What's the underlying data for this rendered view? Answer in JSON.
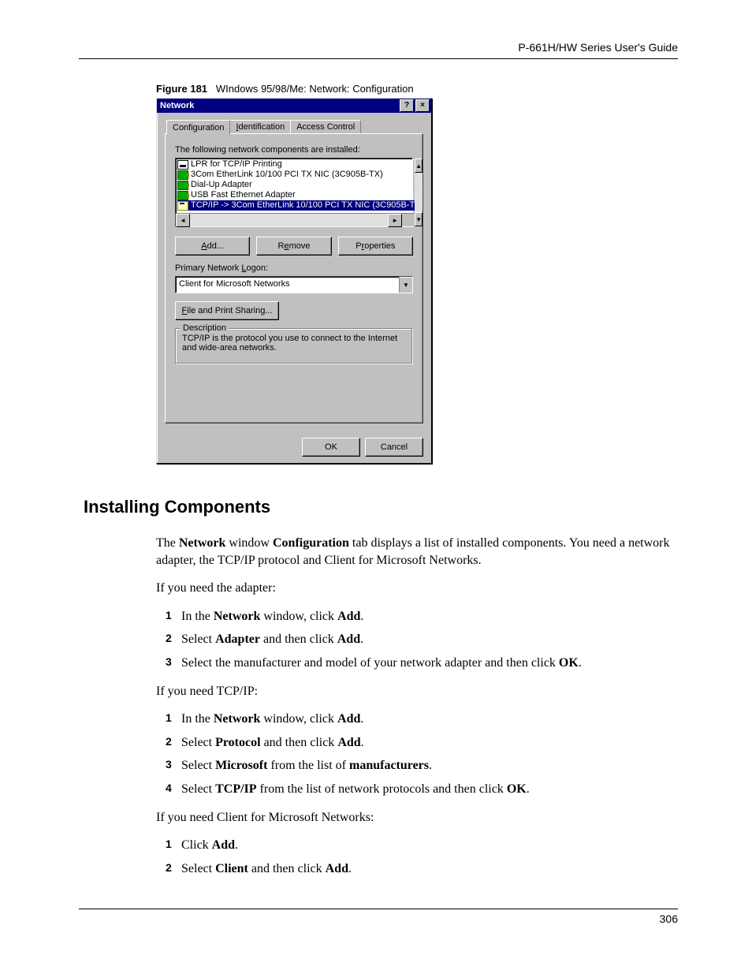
{
  "header": {
    "guide_title": "P-661H/HW Series User's Guide"
  },
  "figure": {
    "label": "Figure 181",
    "caption": "WIndows 95/98/Me: Network: Configuration"
  },
  "dialog": {
    "title": "Network",
    "title_help": "?",
    "title_close": "×",
    "tabs": {
      "configuration": "Configuration",
      "identification": "Identification",
      "access_control": "Access Control"
    },
    "list_label": "The following network components are installed:",
    "items": [
      "LPR for TCP/IP Printing",
      "3Com EtherLink 10/100 PCI TX NIC (3C905B-TX)",
      "Dial-Up Adapter",
      "USB Fast Ethernet Adapter",
      "TCP/IP -> 3Com EtherLink 10/100 PCI TX NIC (3C905B-T"
    ],
    "buttons": {
      "add": "Add...",
      "remove": "Remove",
      "properties": "Properties"
    },
    "primary_logon_label": "Primary Network Logon:",
    "primary_logon_value": "Client for Microsoft Networks",
    "file_print": "File and Print Sharing...",
    "desc_label": "Description",
    "desc_text": "TCP/IP is the protocol you use to connect to the Internet and wide-area networks.",
    "ok": "OK",
    "cancel": "Cancel"
  },
  "section_heading": "Installing Components",
  "intro": {
    "p1a": "The ",
    "p1b": "Network",
    "p1c": " window ",
    "p1d": "Configuration",
    "p1e": " tab displays a list of installed components. You need a network adapter, the TCP/IP protocol and Client for Microsoft Networks.",
    "p2": "If you need the adapter:"
  },
  "adapter_steps": {
    "s1a": "In the ",
    "s1b": "Network",
    "s1c": " window, click ",
    "s1d": "Add",
    "s1e": ".",
    "s2a": "Select ",
    "s2b": "Adapter",
    "s2c": " and then click ",
    "s2d": "Add",
    "s2e": ".",
    "s3a": "Select the manufacturer and model of your network adapter and then click ",
    "s3b": "OK",
    "s3c": "."
  },
  "tcpip_label": "If you need TCP/IP:",
  "tcpip_steps": {
    "s1a": "In the ",
    "s1b": "Network",
    "s1c": " window, click ",
    "s1d": "Add",
    "s1e": ".",
    "s2a": "Select ",
    "s2b": "Protocol",
    "s2c": " and then click ",
    "s2d": "Add",
    "s2e": ".",
    "s3a": "Select ",
    "s3b": "Microsoft",
    "s3c": " from the list of ",
    "s3d": "manufacturers",
    "s3e": ".",
    "s4a": "Select ",
    "s4b": "TCP/IP",
    "s4c": " from the list of network protocols and then click ",
    "s4d": "OK",
    "s4e": "."
  },
  "client_label": "If you need Client for Microsoft Networks:",
  "client_steps": {
    "s1a": "Click ",
    "s1b": "Add",
    "s1c": ".",
    "s2a": "Select ",
    "s2b": "Client",
    "s2c": " and then click ",
    "s2d": "Add",
    "s2e": "."
  },
  "nums": {
    "n1": "1",
    "n2": "2",
    "n3": "3",
    "n4": "4"
  },
  "page_number": "306"
}
